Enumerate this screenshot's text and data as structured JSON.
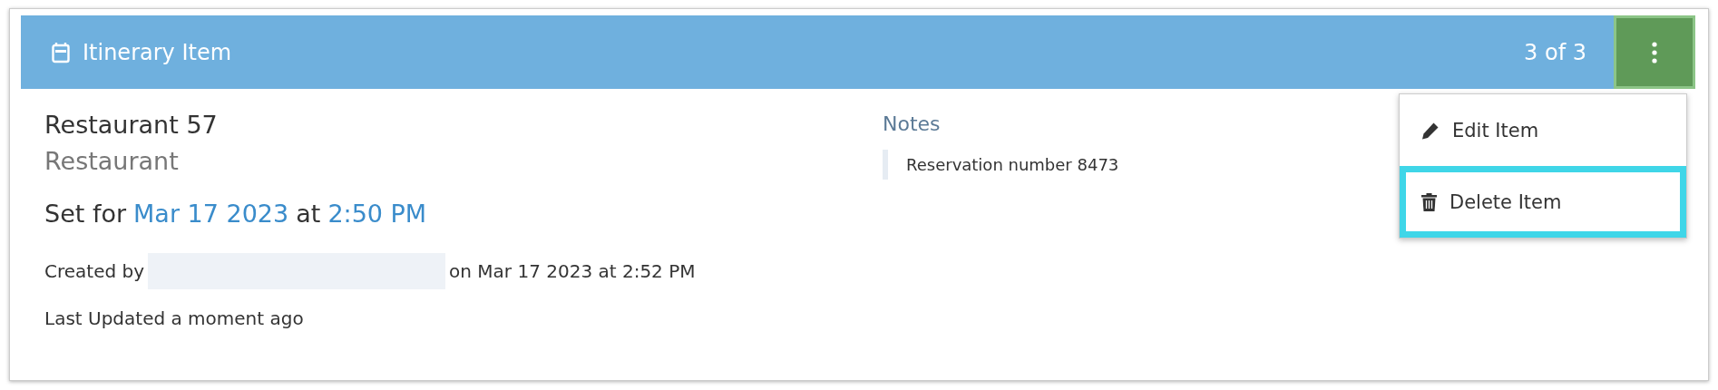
{
  "header": {
    "title": "Itinerary Item",
    "counter": "3 of 3"
  },
  "item": {
    "name": "Restaurant 57",
    "type": "Restaurant"
  },
  "schedule": {
    "prefix": "Set for",
    "date": "Mar 17 2023",
    "connector": "at",
    "time": "2:50 PM"
  },
  "created": {
    "prefix": "Created by",
    "suffix": "on Mar 17 2023 at 2:52 PM"
  },
  "updated": "Last Updated a moment ago",
  "notes": {
    "label": "Notes",
    "text": "Reservation number 8473"
  },
  "menu": [
    {
      "kind": "edit",
      "label": "Edit Item",
      "focused": false
    },
    {
      "kind": "delete",
      "label": "Delete Item",
      "focused": true
    }
  ]
}
